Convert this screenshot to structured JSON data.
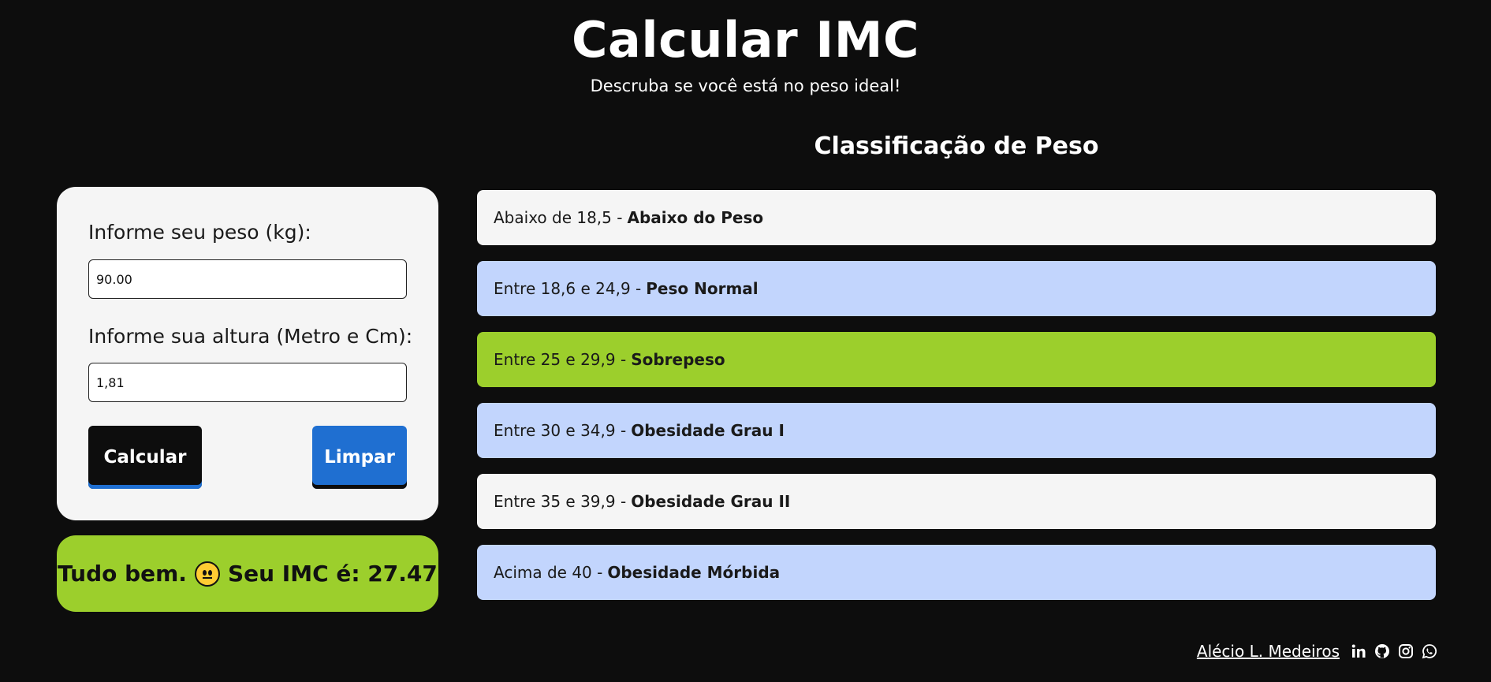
{
  "header": {
    "title": "Calcular IMC",
    "subtitle": "Descruba se você está no peso ideal!"
  },
  "form": {
    "weight_label": "Informe seu peso (kg):",
    "weight_value": "90.00",
    "height_label": "Informe sua altura (Metro e Cm):",
    "height_value": "1,81",
    "calculate_label": "Calcular",
    "clear_label": "Limpar"
  },
  "result": {
    "prefix": "Tudo bem.",
    "emoji": "neutral-face-icon",
    "text": "Seu IMC é: 27.47",
    "background": "#9ccf2c"
  },
  "classification": {
    "heading": "Classificação de Peso",
    "rows": [
      {
        "range": "Abaixo de 18,5 -",
        "name": "Abaixo do Peso",
        "color": "#f5f5f5"
      },
      {
        "range": "Entre 18,6 e 24,9 -",
        "name": "Peso Normal",
        "color": "#c2d5fd"
      },
      {
        "range": "Entre 25 e 29,9 -",
        "name": "Sobrepeso",
        "color": "#9ccf2c"
      },
      {
        "range": "Entre 30 e 34,9 -",
        "name": "Obesidade Grau I",
        "color": "#c2d5fd"
      },
      {
        "range": "Entre 35 e 39,9 -",
        "name": "Obesidade Grau II",
        "color": "#f5f5f5"
      },
      {
        "range": "Acima de 40 -",
        "name": "Obesidade Mórbida",
        "color": "#c2d5fd"
      }
    ]
  },
  "footer": {
    "author": "Alécio L. Medeiros",
    "icons": [
      "linkedin-icon",
      "github-icon",
      "instagram-icon",
      "whatsapp-icon"
    ]
  }
}
